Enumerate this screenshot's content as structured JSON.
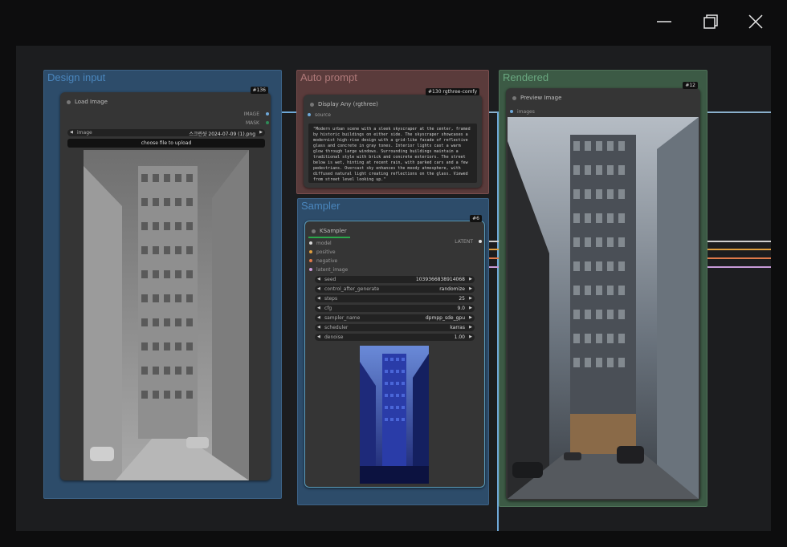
{
  "window": {
    "minimize_icon": "minimize-icon",
    "restore_icon": "restore-icon",
    "close_icon": "close-icon"
  },
  "colors": {
    "group_blue": "#2d4c6a",
    "group_red": "#5a3b3b",
    "group_green": "#3c5a45",
    "node_bg": "#353535"
  },
  "groups": {
    "design_input": {
      "title": "Design input"
    },
    "auto_prompt": {
      "title": "Auto prompt"
    },
    "sampler": {
      "title": "Sampler"
    },
    "rendered": {
      "title": "Rendered"
    }
  },
  "load_image": {
    "title": "Load Image",
    "badge": "#136",
    "output_image": "IMAGE",
    "output_mask": "MASK",
    "image_label": "image",
    "image_value": "스크린샷 2024-07-09 (1).png",
    "upload_button": "choose file to upload"
  },
  "display_any": {
    "title": "Display Any (rgthree)",
    "badge": "#130 rgthree-comfy",
    "input_source": "source",
    "text": "\"Modern urban scene with a sleek skyscraper at the center, framed by historic buildings on either side. The skyscraper showcases a modernist high-rise design with a grid-like facade of reflective glass and concrete in gray tones. Interior lights cast a warm glow through large windows. Surrounding buildings maintain a traditional style with brick and concrete exteriors. The street below is wet, hinting at recent rain, with parked cars and a few pedestrians. Overcast sky enhances the moody atmosphere, with diffused natural light creating reflections on the glass. Viewed from street level looking up.\""
  },
  "ksampler": {
    "title": "KSampler",
    "badge": "#6",
    "inputs": [
      "model",
      "positive",
      "negative",
      "latent_image"
    ],
    "output": "LATENT",
    "widgets": [
      {
        "label": "seed",
        "value": "1039366838914068"
      },
      {
        "label": "control_after_generate",
        "value": "randomize"
      },
      {
        "label": "steps",
        "value": "25"
      },
      {
        "label": "cfg",
        "value": "9.0"
      },
      {
        "label": "sampler_name",
        "value": "dpmpp_sde_gpu"
      },
      {
        "label": "scheduler",
        "value": "karras"
      },
      {
        "label": "denoise",
        "value": "1.00"
      }
    ]
  },
  "preview_image": {
    "title": "Preview Image",
    "badge": "#12",
    "input_images": "images"
  }
}
